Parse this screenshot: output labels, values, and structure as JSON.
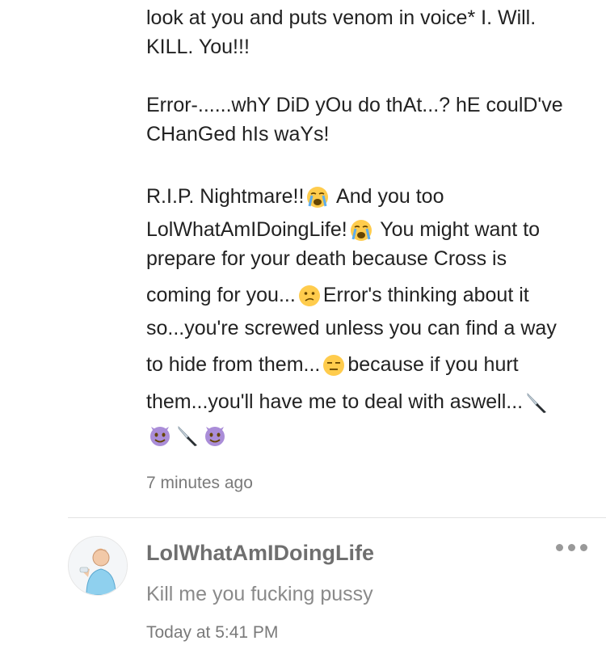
{
  "comment": {
    "lines": {
      "l1": "look at you and puts venom in voice* I. Will.",
      "l2": "KILL. You!!!",
      "l3": "Error-......whY DiD yOu do thAt...? hE coulD've",
      "l4": "CHanGed hIs waYs!",
      "l5a": "R.I.P. Nightmare!!",
      "l5b": "And you too",
      "l6a": "LolWhatAmIDoingLife!",
      "l6b": "You might want to",
      "l7": "prepare for your death because Cross is",
      "l8a": "coming for you...",
      "l8b": "Error's thinking about it",
      "l9": "so...you're screwed unless you can find a way",
      "l10a": "to hide from them...",
      "l10b": "because if you hurt",
      "l11": "them...you'll have me to deal with aswell..."
    },
    "emoji_icons": [
      "loudly-crying-face",
      "confused-face",
      "expressionless-face",
      "knife",
      "smiling-face-with-horns"
    ],
    "timestamp": "7 minutes ago"
  },
  "reply": {
    "author": "LolWhatAmIDoingLife",
    "text": "Kill me you fucking pussy",
    "timestamp": "Today at 5:41 PM",
    "more_icon": "more-horizontal-icon"
  }
}
